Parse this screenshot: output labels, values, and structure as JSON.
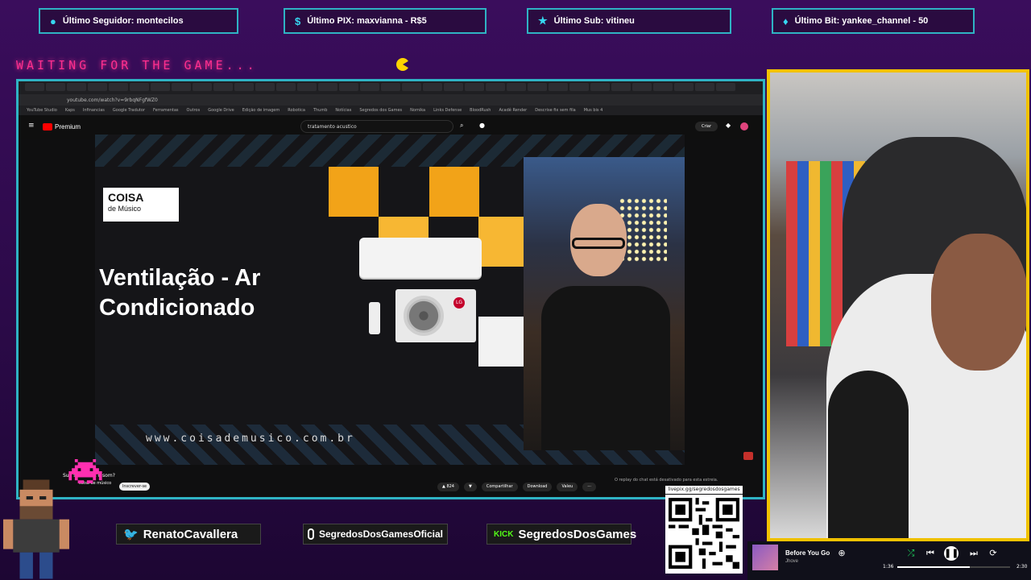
{
  "alerts": [
    {
      "icon": "user-icon",
      "text": "Último Seguidor: montecilos"
    },
    {
      "icon": "dollar-icon",
      "text": "Último PIX: maxvianna - R$5"
    },
    {
      "icon": "star-icon",
      "text": "Último Sub: vitineu"
    },
    {
      "icon": "diamond-icon",
      "text": "Último Bit: yankee_channel - 50"
    }
  ],
  "ticker": "WAITING FOR THE GAME...",
  "browser": {
    "url": "youtube.com/watch?v=9rbqNFgfWZ0",
    "bookmarks": [
      "YouTube Studio",
      "Kaps",
      "Infinancias",
      "Google Tradutor",
      "Ferramentas",
      "Outros",
      "Google Drive",
      "Edição de imagem",
      "Robotica",
      "Thumb",
      "Notícias",
      "Segredos dos Games",
      "Nomika",
      "Links Defense",
      "BloodRush",
      "Acadê Render",
      "Descrise fix sem fila",
      "Mus bis 4"
    ]
  },
  "youtube": {
    "logo": "Premium",
    "search": "tratamento acustico",
    "create": "Criar",
    "video": {
      "brand": "COISA",
      "brand_sub": "de Músico",
      "title_line1": "Ventilação - Ar",
      "title_line2": "Condicionado",
      "site": "www.coisademusico.com.br",
      "lg": "LG"
    },
    "video_title": "Sua sala mais o som?",
    "channel": "coisa de músico",
    "subscribe": "Inscrever-se",
    "likes": "824",
    "share": "Compartilhar",
    "download": "Download",
    "thanks": "Valeu",
    "chat_disabled": "O replay do chat está desativado para esta estreia."
  },
  "socials": [
    {
      "icon": "twitter-icon",
      "handle": "RenatoCavallera"
    },
    {
      "icon": "instagram-icon",
      "handle": "SegredosDosGamesOficial"
    },
    {
      "icon": "kick-icon",
      "label": "KICK",
      "handle": "SegredosDosGames"
    }
  ],
  "qr_label": "livepix.gg/segredosdosgames",
  "music": {
    "title": "Before You Go",
    "artist": "Jhove",
    "elapsed": "1:36",
    "duration": "2:30",
    "progress": 0.64
  },
  "colors": {
    "frame": "#2fb3c4",
    "cam_border": "#f2c200",
    "ticker": "#ff2f8f",
    "background": "#3a0d5c"
  }
}
